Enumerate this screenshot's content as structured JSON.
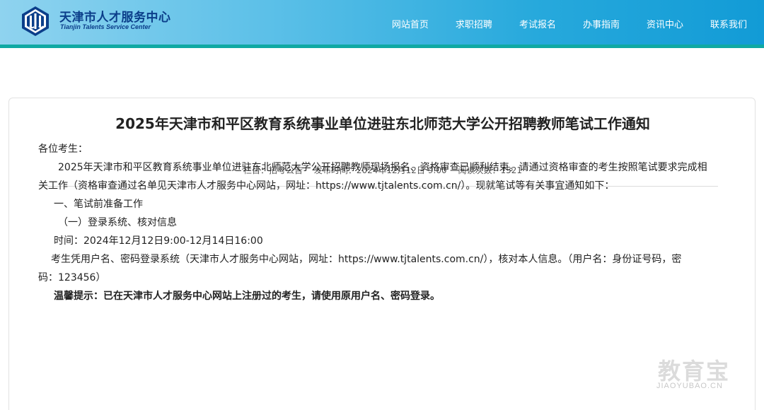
{
  "header": {
    "logo_cn": "天津市人才服务中心",
    "logo_en": "Tianjin Talents Service Center",
    "logo_mark": "JJC",
    "nav": [
      {
        "label": "网站首页"
      },
      {
        "label": "求职招聘"
      },
      {
        "label": "考试报名"
      },
      {
        "label": "办事指南"
      },
      {
        "label": "资讯中心"
      },
      {
        "label": "联系我们"
      }
    ],
    "colors": {
      "gradient_start": "#8fd3ef",
      "gradient_end": "#129bd6",
      "bar": "#0fa9a3",
      "brand_text": "#0b3e8a"
    }
  },
  "article": {
    "title": "2025年天津市和平区教育系统事业单位进驻东北师范大学公开招聘教师笔试工作通知",
    "meta": {
      "column": "栏目：招考公告",
      "publish_time": "发布时间：2024年12月12日 9:00",
      "views": "阅读次数：1521"
    },
    "paragraphs": {
      "greeting": "各位考生：",
      "p1_line1": "2025年天津市和平区教育系统事业单位进驻东北师范大学公开招聘教师现场报名、资格审查已顺利结束。请通过资格审查的考生按照笔试要求完成相",
      "p1_line2": "关工作（资格审查通过名单见天津市人才服务中心网站，网址：https://www.tjtalents.com.cn/）。现就笔试等有关事宜通知如下：",
      "section1": "一、笔试前准备工作",
      "sub1": "（一）登录系统、核对信息",
      "time": "时间：2024年12月12日9:00-12月14日16:00",
      "login_line1": "考生凭用户名、密码登录系统（天津市人才服务中心网站，网址：https://www.tjtalents.com.cn/），核对本人信息。（用户名：身份证号码，密",
      "login_line2": "码：123456）",
      "tip": "温馨提示：已在天津市人才服务中心网站上注册过的考生，请使用原用户名、密码登录。"
    }
  },
  "watermark": {
    "cn": "教育宝",
    "en": "JIAOYUBAO.CN"
  }
}
